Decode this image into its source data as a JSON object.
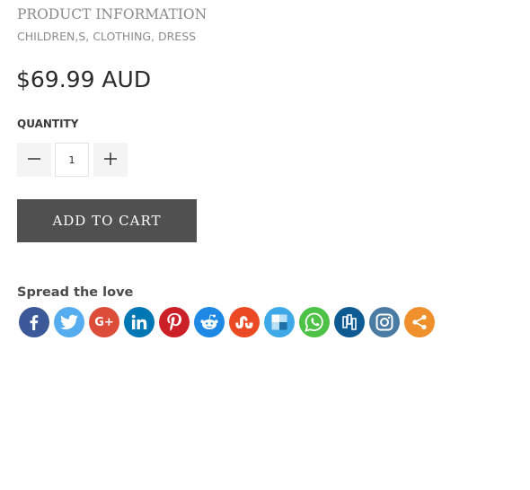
{
  "product": {
    "section_title": "PRODUCT INFORMATION",
    "tags": [
      "CHILDREN,S",
      "CLOTHING",
      "DRESS"
    ],
    "tag_separator": ", ",
    "price": "$69.99 AUD"
  },
  "quantity": {
    "label": "QUANTITY",
    "value": "1"
  },
  "cart": {
    "add_label": "ADD TO CART"
  },
  "share": {
    "title": "Spread the love",
    "buttons": [
      {
        "name": "facebook",
        "icon": "facebook-icon",
        "color": "#3b5998"
      },
      {
        "name": "twitter",
        "icon": "twitter-icon",
        "color": "#55acee"
      },
      {
        "name": "google-plus",
        "icon": "google-plus-icon",
        "color": "#dd4b39"
      },
      {
        "name": "linkedin",
        "icon": "linkedin-icon",
        "color": "#0077b5"
      },
      {
        "name": "pinterest",
        "icon": "pinterest-icon",
        "color": "#cb2027"
      },
      {
        "name": "reddit",
        "icon": "reddit-icon",
        "color": "#1e88e5"
      },
      {
        "name": "stumbleupon",
        "icon": "stumbleupon-icon",
        "color": "#eb4924"
      },
      {
        "name": "delicious",
        "icon": "delicious-icon",
        "color": "#3ea9e6"
      },
      {
        "name": "whatsapp",
        "icon": "whatsapp-icon",
        "color": "#4dc247"
      },
      {
        "name": "mix",
        "icon": "mix-icon",
        "color": "#0e5a93"
      },
      {
        "name": "instagram",
        "icon": "instagram-icon",
        "color": "#4a7ca3"
      },
      {
        "name": "more-share",
        "icon": "share-icon",
        "color": "#f0902c"
      }
    ]
  }
}
